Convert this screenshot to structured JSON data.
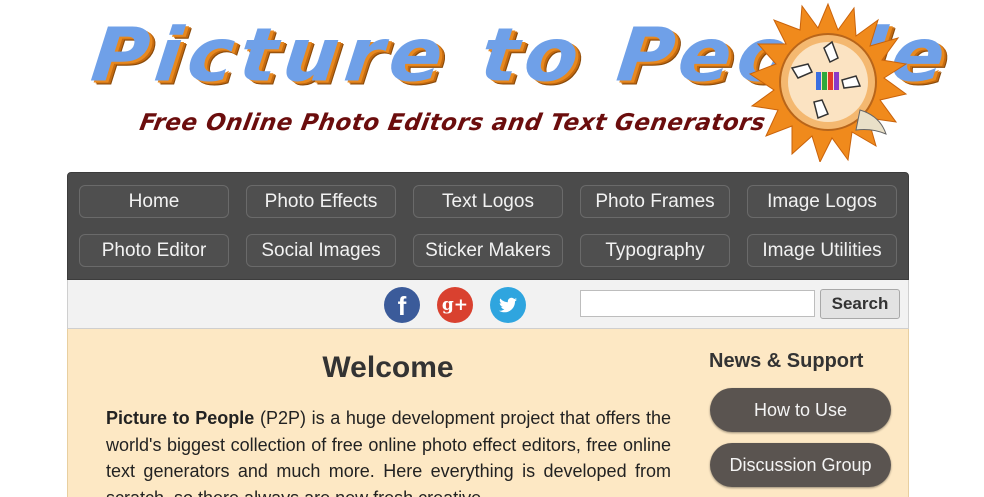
{
  "header": {
    "title": "Picture to People",
    "subtitle": "Free Online Photo Editors and Text Generators"
  },
  "nav": {
    "items": [
      {
        "label": "Home"
      },
      {
        "label": "Photo Effects"
      },
      {
        "label": "Text Logos"
      },
      {
        "label": "Photo Frames"
      },
      {
        "label": "Image Logos"
      },
      {
        "label": "Photo Editor"
      },
      {
        "label": "Social Images"
      },
      {
        "label": "Sticker Makers"
      },
      {
        "label": "Typography"
      },
      {
        "label": "Image Utilities"
      }
    ]
  },
  "social": {
    "facebook_glyph": "f",
    "googleplus_glyph": "g+",
    "icons": [
      "facebook-icon",
      "google-plus-icon",
      "twitter-icon"
    ]
  },
  "search": {
    "placeholder": "",
    "button_label": "Search"
  },
  "main": {
    "welcome_title": "Welcome",
    "intro_strong": "Picture to People",
    "intro_rest": " (P2P) is a huge development project that offers the world's biggest collection of free online photo effect editors, free online text generators and much more. Here everything is developed from scratch, so there always are new fresh creative"
  },
  "sidebar": {
    "title": "News & Support",
    "buttons": [
      {
        "label": "How to Use"
      },
      {
        "label": "Discussion Group"
      }
    ]
  },
  "colors": {
    "nav_bg": "#4b4b4b",
    "content_bg": "#fde8c4",
    "facebook": "#3b5b9a",
    "googleplus": "#d9412f",
    "twitter": "#2fa5df",
    "logo_blue": "#6fa0e8",
    "logo_orange": "#e8891f",
    "subtitle": "#6b0d0d"
  }
}
